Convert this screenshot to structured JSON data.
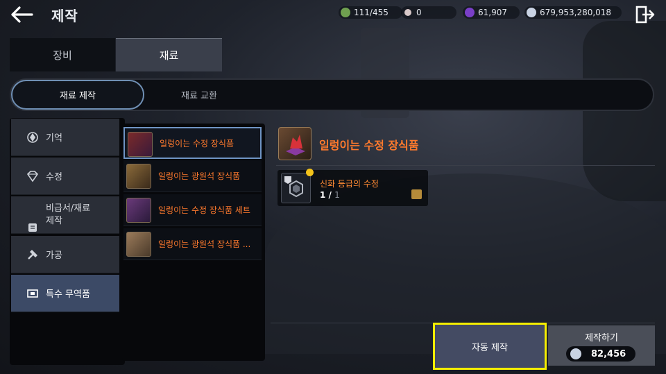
{
  "header": {
    "title": "제작",
    "currencies": [
      {
        "name": "weight",
        "value": "111/455",
        "color": "#6fa050"
      },
      {
        "name": "pearl",
        "value": "0",
        "color": "#d8c8c8"
      },
      {
        "name": "crystal",
        "value": "61,907",
        "color": "#7a3fc8"
      },
      {
        "name": "silver",
        "value": "679,953,280,018",
        "color": "#c9d3e3"
      }
    ]
  },
  "main_tabs": [
    {
      "label": "장비",
      "active": false
    },
    {
      "label": "재료",
      "active": true
    }
  ],
  "sub_tabs": [
    {
      "label": "재료 제작",
      "active": true
    },
    {
      "label": "재료 교환",
      "active": false
    }
  ],
  "categories": [
    {
      "label": "기억",
      "icon": "memory-icon"
    },
    {
      "label": "수정",
      "icon": "crystal-icon"
    },
    {
      "label": "비급서/재료\n제작",
      "icon": "scroll-icon"
    },
    {
      "label": "가공",
      "icon": "hammer-icon"
    },
    {
      "label": "특수 무역품",
      "icon": "trade-icon",
      "active": true
    }
  ],
  "recipes": [
    {
      "label": "일렁이는 수정 장식품",
      "active": true
    },
    {
      "label": "일렁이는 광원석 장식품"
    },
    {
      "label": "일렁이는 수정 장식품 세트"
    },
    {
      "label": "일렁이는 광원석 장식품 ..."
    }
  ],
  "detail": {
    "title": "일렁이는 수정 장식품",
    "materials": [
      {
        "name": "신화 등급의 수정",
        "owned": "1",
        "sep": "/",
        "required": "1"
      }
    ]
  },
  "buttons": {
    "auto_craft": "자동 제작",
    "craft": "제작하기",
    "craft_cost": "82,456"
  },
  "colors": {
    "highlight": "#f5ee00",
    "accent_orange": "#ff7a2d",
    "active_border": "#6f94c4"
  }
}
